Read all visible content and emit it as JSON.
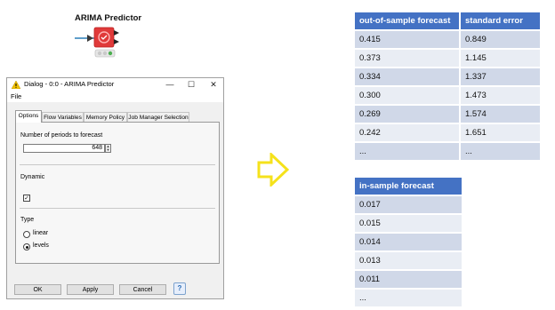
{
  "node": {
    "title": "ARIMA Predictor",
    "icon": "arima-node-icon",
    "status_colors": [
      "#cfcfcf",
      "#cfcfcf",
      "#5cb85c"
    ]
  },
  "dialog": {
    "title": "Dialog - 0:0 - ARIMA Predictor",
    "menu": [
      "File"
    ],
    "tabs": [
      "Options",
      "Flow Variables",
      "Memory Policy",
      "Job Manager Selection"
    ],
    "active_tab": "Options",
    "periods_label": "Number of periods to forecast",
    "periods_value": "648",
    "dynamic_label": "Dynamic",
    "dynamic_checked": true,
    "type_label": "Type",
    "type_options": [
      "linear",
      "levels"
    ],
    "type_selected": "levels",
    "buttons": {
      "ok": "OK",
      "apply": "Apply",
      "cancel": "Cancel",
      "help": "?"
    }
  },
  "arrow_color": "#f5e21b",
  "out_of_sample": {
    "headers": [
      "out-of-sample forecast",
      "standard error"
    ],
    "rows": [
      [
        "0.415",
        "0.849"
      ],
      [
        "0.373",
        "1.145"
      ],
      [
        "0.334",
        "1.337"
      ],
      [
        "0.300",
        "1.473"
      ],
      [
        "0.269",
        "1.574"
      ],
      [
        "0.242",
        "1.651"
      ],
      [
        "...",
        "..."
      ]
    ]
  },
  "in_sample": {
    "headers": [
      "in-sample forecast"
    ],
    "rows": [
      [
        "0.017"
      ],
      [
        "0.015"
      ],
      [
        "0.014"
      ],
      [
        "0.013"
      ],
      [
        "0.011"
      ],
      [
        "..."
      ]
    ]
  },
  "colors": {
    "header": "#4472c4",
    "row_dark": "#d0d8e8",
    "row_light": "#e9edf4"
  }
}
